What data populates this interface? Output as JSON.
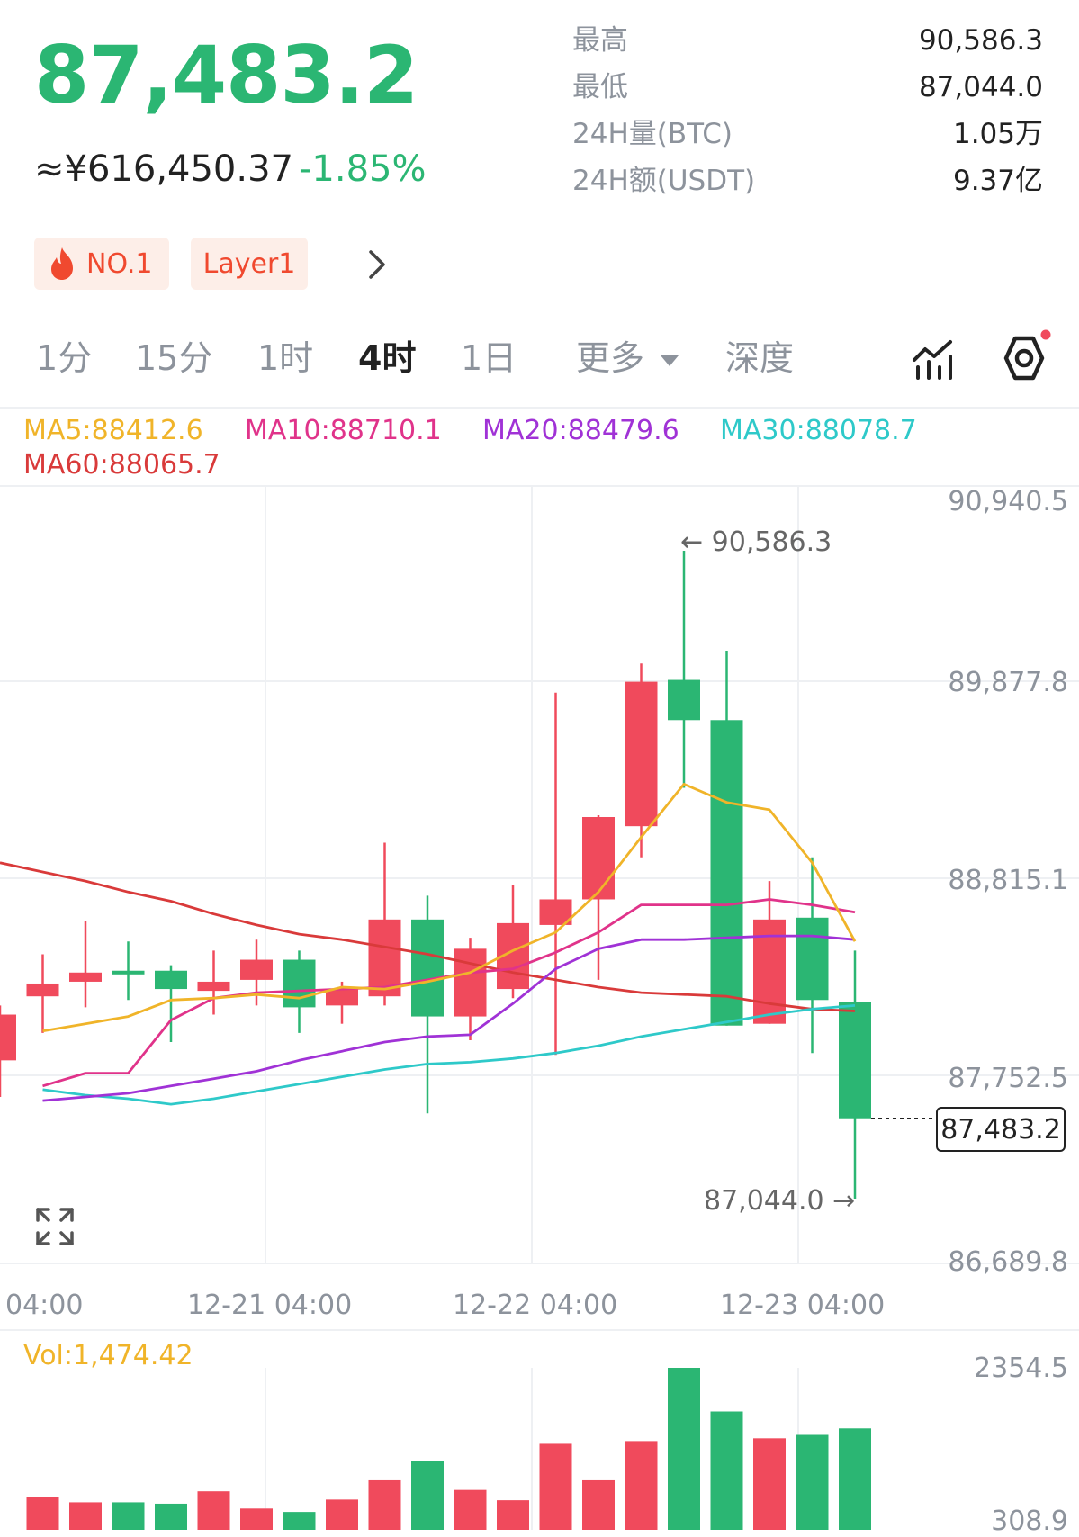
{
  "header": {
    "last_price": "87,483.2",
    "cny_price": "≈¥616,450.37",
    "change_pct": "-1.85%",
    "stats": [
      {
        "label": "最高",
        "value": "90,586.3"
      },
      {
        "label": "最低",
        "value": "87,044.0"
      },
      {
        "label": "24H量(BTC)",
        "value": "1.05万"
      },
      {
        "label": "24H额(USDT)",
        "value": "9.37亿"
      }
    ],
    "tags": [
      {
        "label": "NO.1",
        "icon": "flame-icon"
      },
      {
        "label": "Layer1"
      }
    ]
  },
  "timeframes": {
    "tabs": [
      "1分",
      "15分",
      "1时",
      "4时",
      "1日"
    ],
    "active": "4时",
    "more_label": "更多",
    "depth_label": "深度"
  },
  "colors": {
    "up": "#f04a5c",
    "down": "#2bb673",
    "ma5": "#f0b429",
    "ma10": "#e0338a",
    "ma20": "#a032d6",
    "ma30": "#2ec9c9",
    "ma60": "#d93a3a"
  },
  "indicators": {
    "ma5": "MA5:88412.6",
    "ma10": "MA10:88710.1",
    "ma20": "MA20:88479.6",
    "ma30": "MA30:88078.7",
    "ma60": "MA60:88065.7"
  },
  "chart_data": {
    "type": "candlestick",
    "price_axis": [
      "90,940.5",
      "89,877.8",
      "88,815.1",
      "87,752.5",
      "86,689.8"
    ],
    "ylim": [
      86689.8,
      90940.5
    ],
    "x_labels": [
      "04:00",
      "12-21 04:00",
      "12-22 04:00",
      "12-23 04:00"
    ],
    "high_marker": "← 90,586.3",
    "low_marker": "87,044.0 →",
    "current_price": "87,483.2",
    "candles": [
      {
        "o": 87800,
        "h": 88100,
        "l": 87600,
        "c": 88050
      },
      {
        "o": 88150,
        "h": 88380,
        "l": 87950,
        "c": 88220
      },
      {
        "o": 88230,
        "h": 88560,
        "l": 88090,
        "c": 88280
      },
      {
        "o": 88290,
        "h": 88450,
        "l": 88130,
        "c": 88270
      },
      {
        "o": 88290,
        "h": 88320,
        "l": 87900,
        "c": 88190
      },
      {
        "o": 88180,
        "h": 88400,
        "l": 88050,
        "c": 88230
      },
      {
        "o": 88240,
        "h": 88460,
        "l": 88100,
        "c": 88350
      },
      {
        "o": 88350,
        "h": 88400,
        "l": 87950,
        "c": 88090
      },
      {
        "o": 88100,
        "h": 88230,
        "l": 88000,
        "c": 88190
      },
      {
        "o": 88150,
        "h": 88990,
        "l": 88100,
        "c": 88570
      },
      {
        "o": 88570,
        "h": 88700,
        "l": 87510,
        "c": 88040
      },
      {
        "o": 88040,
        "h": 88470,
        "l": 87910,
        "c": 88410
      },
      {
        "o": 88190,
        "h": 88760,
        "l": 88140,
        "c": 88550
      },
      {
        "o": 88540,
        "h": 89810,
        "l": 87830,
        "c": 88680
      },
      {
        "o": 88680,
        "h": 89140,
        "l": 88240,
        "c": 89130
      },
      {
        "o": 89080,
        "h": 89970,
        "l": 88910,
        "c": 89870
      },
      {
        "o": 89880,
        "h": 90586.3,
        "l": 89290,
        "c": 89660
      },
      {
        "o": 89660,
        "h": 90040,
        "l": 87990,
        "c": 87990
      },
      {
        "o": 88000,
        "h": 88780,
        "l": 88000,
        "c": 88570
      },
      {
        "o": 88580,
        "h": 88910,
        "l": 87840,
        "c": 88130
      },
      {
        "o": 88120,
        "h": 88400,
        "l": 87044.0,
        "c": 87483.2
      }
    ],
    "ma_lines": {
      "ma5": [
        87960,
        88000,
        88040,
        88130,
        88140,
        88160,
        88140,
        88200,
        88190,
        88230,
        88280,
        88400,
        88500,
        88720,
        89020,
        89310,
        89210,
        89170,
        88880,
        88450
      ],
      "ma10": [
        87660,
        87730,
        87730,
        88020,
        88140,
        88170,
        88180,
        88190,
        88200,
        88240,
        88280,
        88300,
        88390,
        88500,
        88650,
        88650,
        88650,
        88680,
        88650,
        88610
      ],
      "ma20": [
        87580,
        87600,
        87620,
        87660,
        87700,
        87740,
        87800,
        87850,
        87900,
        87930,
        87940,
        88110,
        88300,
        88410,
        88460,
        88460,
        88470,
        88480,
        88480,
        88460
      ],
      "ma30": [
        87640,
        87610,
        87590,
        87560,
        87590,
        87630,
        87670,
        87710,
        87750,
        87780,
        87790,
        87810,
        87840,
        87880,
        87930,
        87970,
        88010,
        88050,
        88080,
        88100
      ],
      "ma60": [
        88880,
        88830,
        88780,
        88720,
        88670,
        88600,
        88540,
        88490,
        88460,
        88420,
        88380,
        88330,
        88280,
        88240,
        88200,
        88170,
        88160,
        88150,
        88110,
        88080,
        88070
      ]
    },
    "volume": {
      "label": "Vol:1,474.42",
      "axis": [
        "2354.5",
        "308.9"
      ],
      "values": [
        480,
        400,
        400,
        380,
        560,
        310,
        260,
        440,
        720,
        1000,
        580,
        430,
        1250,
        720,
        1290,
        2354.5,
        1720,
        1330,
        1380,
        1474.42
      ]
    }
  }
}
